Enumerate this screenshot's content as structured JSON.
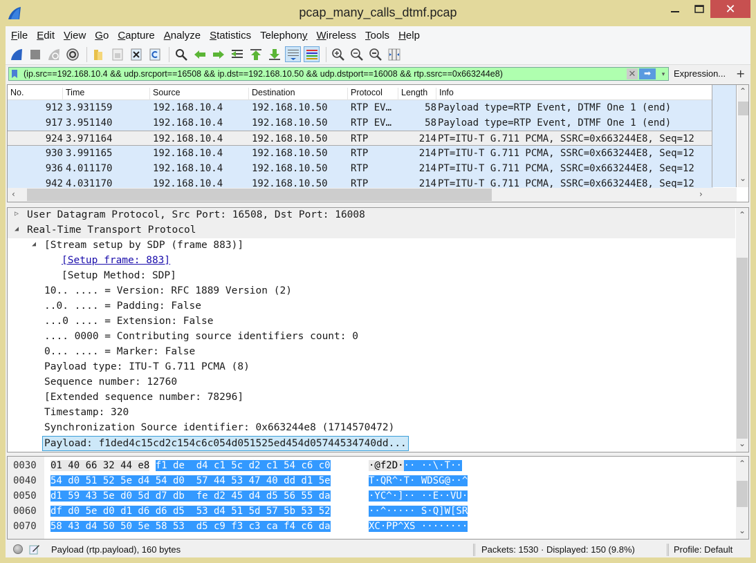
{
  "window": {
    "title": "pcap_many_calls_dtmf.pcap",
    "minimize_label": "_",
    "maximize_label": "□",
    "close_label": "✕"
  },
  "menubar": {
    "items": [
      {
        "label": "File",
        "mnemonic": "F",
        "rest": "ile"
      },
      {
        "label": "Edit",
        "mnemonic": "E",
        "rest": "dit"
      },
      {
        "label": "View",
        "mnemonic": "V",
        "rest": "iew"
      },
      {
        "label": "Go",
        "mnemonic": "G",
        "rest": "o"
      },
      {
        "label": "Capture",
        "mnemonic": "C",
        "rest": "apture"
      },
      {
        "label": "Analyze",
        "mnemonic": "A",
        "rest": "nalyze"
      },
      {
        "label": "Statistics",
        "mnemonic": "S",
        "rest": "tatistics"
      },
      {
        "label": "Telephony",
        "mnemonic": "y",
        "pre": "Telephon",
        "rest": ""
      },
      {
        "label": "Wireless",
        "mnemonic": "W",
        "rest": "ireless"
      },
      {
        "label": "Tools",
        "mnemonic": "T",
        "rest": "ools"
      },
      {
        "label": "Help",
        "mnemonic": "H",
        "rest": "elp"
      }
    ]
  },
  "toolbar": {
    "buttons": [
      "start-capture-icon",
      "stop-capture-icon",
      "restart-capture-icon",
      "capture-options-icon",
      "open-file-icon",
      "save-file-icon",
      "close-file-icon",
      "reload-file-icon",
      "find-packet-icon",
      "go-back-icon",
      "go-forward-icon",
      "go-to-packet-icon",
      "go-first-icon",
      "go-last-icon",
      "autoscroll-icon",
      "colorize-icon",
      "zoom-in-icon",
      "zoom-out-icon",
      "zoom-normal-icon",
      "resize-columns-icon"
    ]
  },
  "filter": {
    "value": "(ip.src==192.168.10.4 && udp.srcport==16508 && ip.dst==192.168.10.50 && udp.dstport==16008 && rtp.ssrc==0x663244e8)",
    "clear_label": "✕",
    "apply_label": "➡",
    "dropdown_label": "▾",
    "expression_label": "Expression...",
    "add_label": "+",
    "background_color": "#afffaf"
  },
  "packet_list": {
    "columns": [
      "No.",
      "Time",
      "Source",
      "Destination",
      "Protocol",
      "Length",
      "Info"
    ],
    "rows": [
      {
        "no": "912",
        "time": "3.931159",
        "src": "192.168.10.4",
        "dst": "192.168.10.50",
        "proto": "RTP EV…",
        "len": "58",
        "info": "Payload type=RTP Event, DTMF One 1 (end)",
        "selected": false
      },
      {
        "no": "917",
        "time": "3.951140",
        "src": "192.168.10.4",
        "dst": "192.168.10.50",
        "proto": "RTP EV…",
        "len": "58",
        "info": "Payload type=RTP Event, DTMF One 1 (end)",
        "selected": false
      },
      {
        "no": "924",
        "time": "3.971164",
        "src": "192.168.10.4",
        "dst": "192.168.10.50",
        "proto": "RTP",
        "len": "214",
        "info": "PT=ITU-T G.711 PCMA, SSRC=0x663244E8, Seq=12",
        "selected": true
      },
      {
        "no": "930",
        "time": "3.991165",
        "src": "192.168.10.4",
        "dst": "192.168.10.50",
        "proto": "RTP",
        "len": "214",
        "info": "PT=ITU-T G.711 PCMA, SSRC=0x663244E8, Seq=12",
        "selected": false
      },
      {
        "no": "936",
        "time": "4.011170",
        "src": "192.168.10.4",
        "dst": "192.168.10.50",
        "proto": "RTP",
        "len": "214",
        "info": "PT=ITU-T G.711 PCMA, SSRC=0x663244E8, Seq=12",
        "selected": false
      },
      {
        "no": "942",
        "time": "4.031170",
        "src": "192.168.10.4",
        "dst": "192.168.10.50",
        "proto": "RTP",
        "len": "214",
        "info": "PT=ITU-T G.711 PCMA, SSRC=0x663244E8, Seq=12",
        "selected": false
      }
    ],
    "row_color": "#daeafb"
  },
  "details": {
    "rows": [
      {
        "text": "User Datagram Protocol, Src Port: 16508, Dst Port: 16008",
        "indent": 0,
        "twisty": "▷",
        "header": true
      },
      {
        "text": "Real-Time Transport Protocol",
        "indent": 0,
        "twisty": "◢",
        "header": true
      },
      {
        "text": "[Stream setup by SDP (frame 883)]",
        "indent": 1,
        "twisty": "◢"
      },
      {
        "text": "[Setup frame: 883]",
        "indent": 2,
        "link": true
      },
      {
        "text": "[Setup Method: SDP]",
        "indent": 2
      },
      {
        "text": "10.. .... = Version: RFC 1889 Version (2)",
        "indent": 1
      },
      {
        "text": "..0. .... = Padding: False",
        "indent": 1
      },
      {
        "text": "...0 .... = Extension: False",
        "indent": 1
      },
      {
        "text": ".... 0000 = Contributing source identifiers count: 0",
        "indent": 1
      },
      {
        "text": "0... .... = Marker: False",
        "indent": 1
      },
      {
        "text": "Payload type: ITU-T G.711 PCMA (8)",
        "indent": 1
      },
      {
        "text": "Sequence number: 12760",
        "indent": 1
      },
      {
        "text": "[Extended sequence number: 78296]",
        "indent": 1
      },
      {
        "text": "Timestamp: 320",
        "indent": 1
      },
      {
        "text": "Synchronization Source identifier: 0x663244e8 (1714570472)",
        "indent": 1
      },
      {
        "text": "Payload: f1ded4c15cd2c154c6c054d051525ed454d05744534740dd...",
        "indent": 1,
        "selected": true
      }
    ]
  },
  "bytes": {
    "rows": [
      {
        "offset": "0030",
        "pre": "01 40 66 32 44 e8",
        "hex": "f1 de  d4 c1 5c d2 c1 54 c6 c0",
        "pre_ascii": "·@f2D·",
        "ascii": "·· ··\\·T··"
      },
      {
        "offset": "0040",
        "pre": "",
        "hex": "54 d0 51 52 5e d4 54 d0  57 44 53 47 40 dd d1 5e",
        "pre_ascii": "",
        "ascii": "T·QR^·T· WDSG@··^"
      },
      {
        "offset": "0050",
        "pre": "",
        "hex": "d1 59 43 5e d0 5d d7 db  fe d2 45 d4 d5 56 55 da",
        "pre_ascii": "",
        "ascii": "·YC^·]·· ··E··VU·"
      },
      {
        "offset": "0060",
        "pre": "",
        "hex": "df d0 5e d0 d1 d6 d6 d5  53 d4 51 5d 57 5b 53 52",
        "pre_ascii": "",
        "ascii": "··^····· S·Q]W[SR"
      },
      {
        "offset": "0070",
        "pre": "",
        "hex": "58 43 d4 50 50 5e 58 53  d5 c9 f3 c3 ca f4 c6 da",
        "pre_ascii": "",
        "ascii": "XC·PP^XS ········"
      }
    ],
    "highlight_color": "#3399ff"
  },
  "statusbar": {
    "field_info": "Payload (rtp.payload), 160 bytes",
    "packets": "Packets: 1530 · Displayed: 150 (9.8%)",
    "profile": "Profile: Default"
  }
}
